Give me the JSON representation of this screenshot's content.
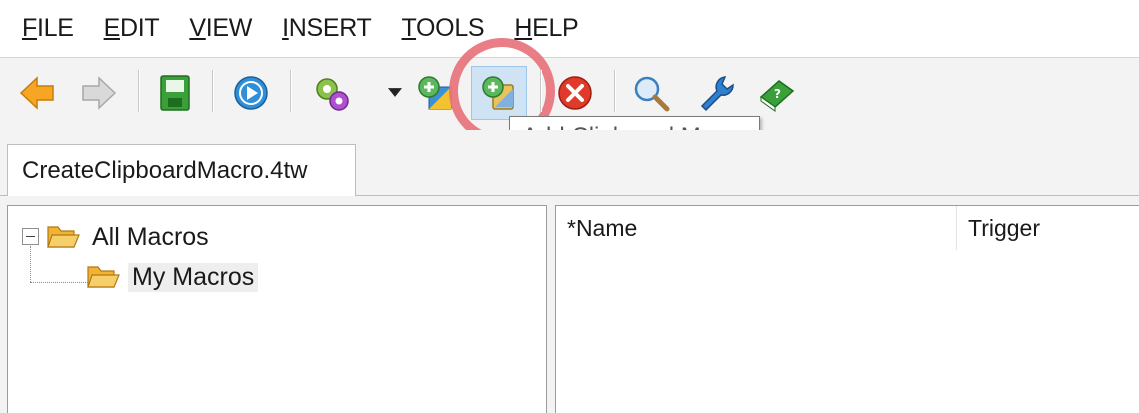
{
  "menu": {
    "items": [
      "FILE",
      "EDIT",
      "VIEW",
      "INSERT",
      "TOOLS",
      "HELP"
    ]
  },
  "toolbar": {
    "buttons": [
      {
        "icon": "back-arrow-icon"
      },
      {
        "icon": "forward-arrow-icon"
      },
      {
        "icon": "save-icon"
      },
      {
        "icon": "play-icon"
      },
      {
        "icon": "add-macro-gears-icon"
      },
      {
        "icon": "add-text-macro-icon"
      },
      {
        "icon": "add-clipboard-macro-icon"
      },
      {
        "icon": "delete-icon"
      },
      {
        "icon": "search-icon"
      },
      {
        "icon": "wrench-icon"
      },
      {
        "icon": "help-book-icon"
      }
    ],
    "tooltip": "Add Clipboard Macro"
  },
  "tabs": [
    {
      "label": "CreateClipboardMacro.4tw"
    }
  ],
  "tree": {
    "root": {
      "label": "All Macros"
    },
    "child": {
      "label": "My Macros"
    }
  },
  "list": {
    "columns": [
      "*Name",
      "Trigger"
    ]
  },
  "colors": {
    "highlight_ring": "#e8707a",
    "folder": "#f2b233",
    "save_green": "#3aa13a",
    "play_blue": "#2f8fd8",
    "delete_red": "#e03b2a",
    "arrow_orange": "#f6a623"
  }
}
